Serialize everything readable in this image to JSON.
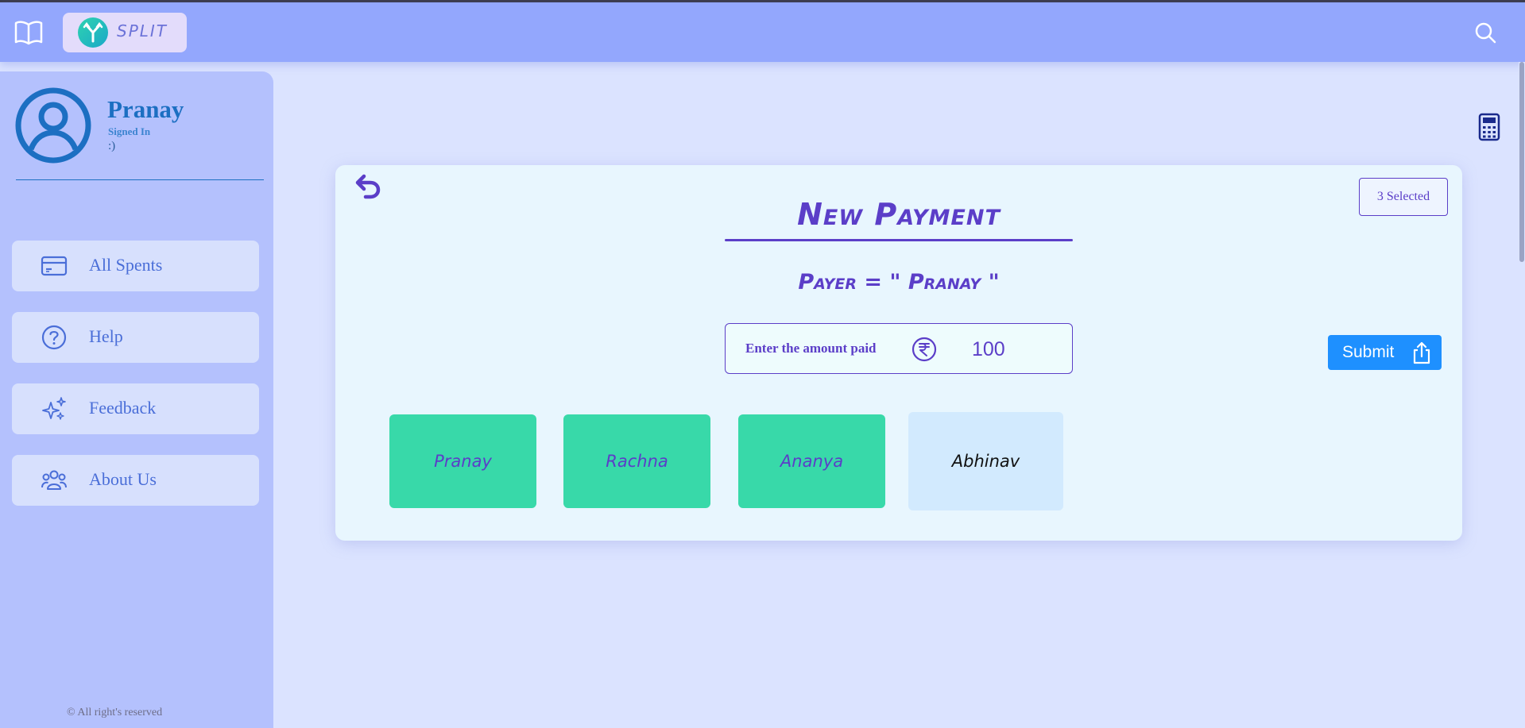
{
  "app": {
    "logo_text": "SPLIT"
  },
  "user": {
    "name": "Pranay",
    "status": "Signed In",
    "tagline": ":)"
  },
  "sidebar": {
    "items": [
      {
        "label": "All Spents",
        "icon": "card-icon"
      },
      {
        "label": "Help",
        "icon": "help-icon"
      },
      {
        "label": "Feedback",
        "icon": "sparkles-icon"
      },
      {
        "label": "About Us",
        "icon": "people-icon"
      }
    ],
    "copyright": "© All right's reserved"
  },
  "payment": {
    "title": "New Payment",
    "payer_line": "Payer = \" Pranay \"",
    "selected_badge": "3 Selected",
    "amount_label": "Enter the amount paid",
    "amount_value": "100",
    "submit_label": "Submit"
  },
  "members": [
    {
      "name": "Pranay",
      "selected": true
    },
    {
      "name": "Rachna",
      "selected": true
    },
    {
      "name": "Ananya",
      "selected": true
    },
    {
      "name": "Abhinav",
      "selected": false
    }
  ],
  "colors": {
    "navbar": "#93a7fd",
    "sidebar": "#b4c1fd",
    "accent": "#5b3ec8",
    "selected_member": "#38d9a9",
    "unselected_member": "#d2eafe",
    "submit": "#1e90ff"
  }
}
